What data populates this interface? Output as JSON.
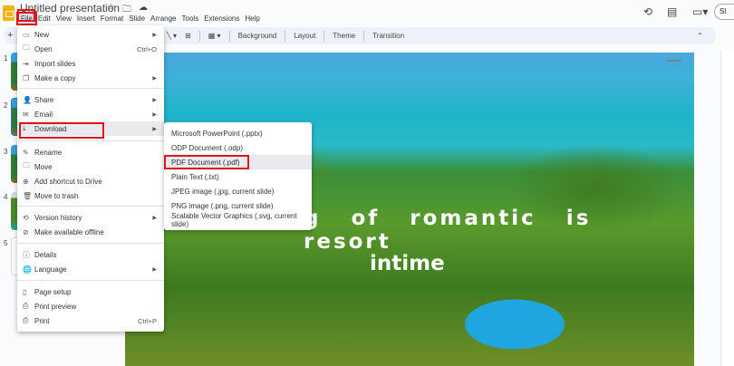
{
  "app": {
    "title": "Untitled presentation",
    "title_icons": [
      "star-icon",
      "folder-move-icon",
      "cloud-status-icon"
    ]
  },
  "menubar": [
    "File",
    "Edit",
    "View",
    "Insert",
    "Format",
    "Slide",
    "Arrange",
    "Tools",
    "Extensions",
    "Help"
  ],
  "header_right": {
    "share_label": "Sl"
  },
  "toolbar": {
    "items": [
      "Background",
      "Layout",
      "Theme",
      "Transition"
    ]
  },
  "filmstrip": {
    "numbers": [
      "1",
      "2",
      "3",
      "4",
      "5"
    ]
  },
  "file_menu": {
    "items": [
      {
        "label": "New",
        "icon": "new-icon",
        "submenu": true
      },
      {
        "label": "Open",
        "icon": "folder-icon",
        "shortcut": "Ctrl+O"
      },
      {
        "label": "Import slides",
        "icon": "import-icon"
      },
      {
        "label": "Make a copy",
        "icon": "copy-icon",
        "submenu": true
      },
      {
        "label": "Share",
        "icon": "share-person-icon",
        "submenu": true
      },
      {
        "label": "Email",
        "icon": "email-icon",
        "submenu": true
      },
      {
        "label": "Download",
        "icon": "download-icon",
        "submenu": true,
        "highlighted": true
      },
      {
        "label": "Rename",
        "icon": "rename-icon"
      },
      {
        "label": "Move",
        "icon": "move-folder-icon"
      },
      {
        "label": "Add shortcut to Drive",
        "icon": "drive-shortcut-icon"
      },
      {
        "label": "Move to trash",
        "icon": "trash-icon"
      },
      {
        "label": "Version history",
        "icon": "history-icon",
        "submenu": true
      },
      {
        "label": "Make available offline",
        "icon": "offline-icon"
      },
      {
        "label": "Details",
        "icon": "info-icon"
      },
      {
        "label": "Language",
        "icon": "globe-icon",
        "submenu": true
      },
      {
        "label": "Page setup",
        "icon": "page-icon"
      },
      {
        "label": "Print preview",
        "icon": "print-preview-icon"
      },
      {
        "label": "Print",
        "icon": "printer-icon",
        "shortcut": "Ctrl+P"
      }
    ]
  },
  "download_menu": {
    "items": [
      "Microsoft PowerPoint (.pptx)",
      "ODP Document (.odp)",
      "PDF Document (.pdf)",
      "Plain Text (.txt)",
      "JPEG image (.jpg, current slide)",
      "PNG image (.png, current slide)",
      "Scalable Vector Graphics (.svg, current slide)"
    ],
    "highlighted": "PDF Document (.pdf)"
  },
  "slide": {
    "line1": "g of romantic is resort",
    "line2": "intime"
  },
  "colors": {
    "highlight_box": "#e0141b",
    "toolbar_bg": "#edf2fa",
    "logo": "#f4b400"
  }
}
